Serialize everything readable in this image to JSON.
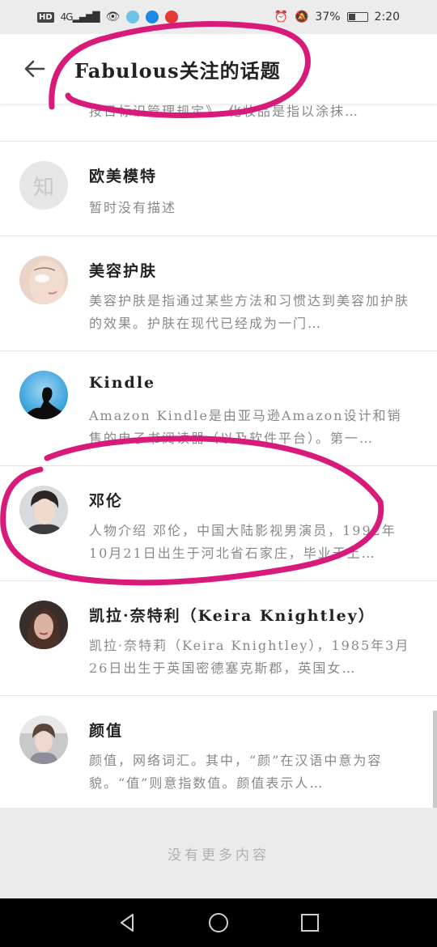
{
  "status_bar": {
    "hd": "HD",
    "network": "4G",
    "battery_text": "37%",
    "battery_level": 0.37,
    "time": "2:20"
  },
  "header": {
    "title": "Fabulous关注的话题"
  },
  "partial_item": {
    "desc": "按日标识管理规定》，化妆品是指以涂抹…"
  },
  "topics": [
    {
      "name": "欧美模特",
      "desc": "暂时没有描述",
      "avatar": "zhi-placeholder-avatar"
    },
    {
      "name": "美容护肤",
      "desc": "美容护肤是指通过某些方法和习惯达到美容加护肤的效果。护肤在现代已经成为一门…",
      "avatar": "skincare-avatar"
    },
    {
      "name": "Kindle",
      "desc": "Amazon Kindle是由亚马逊Amazon设计和销售的电子书阅读器（以及软件平台）。第一…",
      "avatar": "kindle-avatar"
    },
    {
      "name": "邓伦",
      "desc": "人物介绍 邓伦，中国大陆影视男演员，1992年10月21日出生于河北省石家庄，毕业于上…",
      "avatar": "person-avatar"
    },
    {
      "name": "凯拉·奈特利（Keira Knightley）",
      "desc": "凯拉·奈特莉（Keira Knightley），1985年3月26日出生于英国密德塞克斯郡，英国女…",
      "avatar": "person-avatar"
    },
    {
      "name": "颜值",
      "desc": "颜值，网络词汇。其中，“颜”在汉语中意为容貌。“值”则意指数值。颜值表示人…",
      "avatar": "child-avatar"
    }
  ],
  "footer": {
    "text": "没有更多内容"
  },
  "avatar_placeholder_char": "知",
  "colors": {
    "annotation": "#d81b7a",
    "status_bg": "#ececec",
    "footer_bg": "#ebebeb"
  }
}
